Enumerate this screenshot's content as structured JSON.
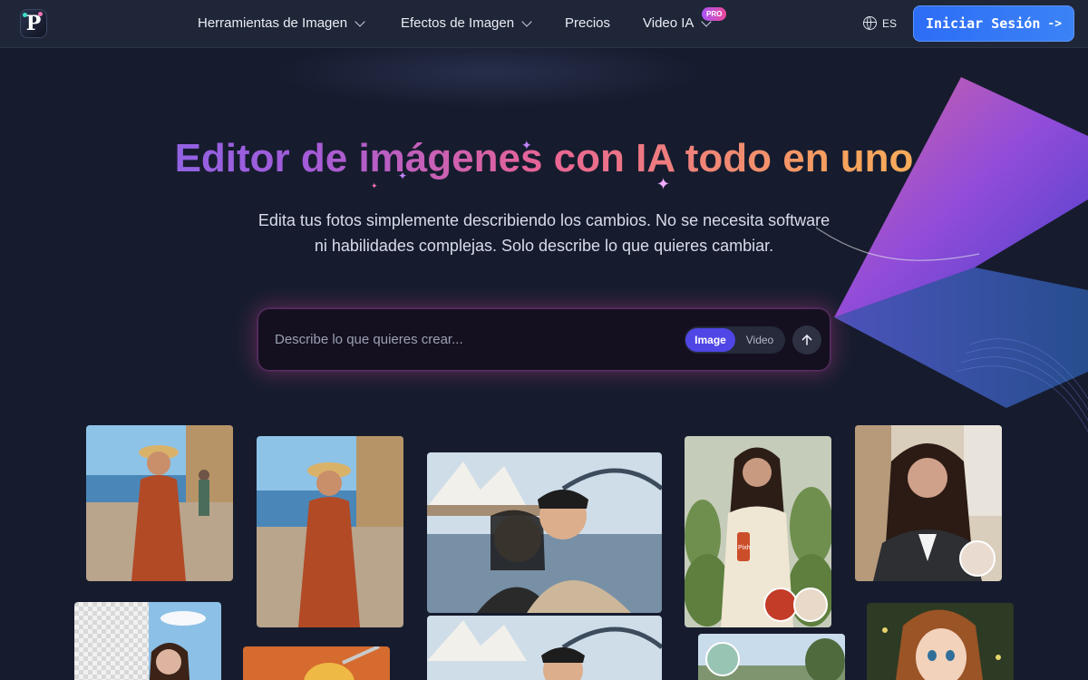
{
  "nav": {
    "logo_letter": "P",
    "items": [
      {
        "label": "Herramientas de Imagen",
        "has_dropdown": true
      },
      {
        "label": "Efectos de Imagen",
        "has_dropdown": true
      },
      {
        "label": "Precios",
        "has_dropdown": false
      },
      {
        "label": "Video IA",
        "has_dropdown": true
      }
    ],
    "pro_badge": "PRO",
    "language": "ES",
    "signin_label": "Iniciar Sesión",
    "signin_arrow": "->"
  },
  "hero": {
    "title": "Editor de imágenes con IA todo en uno",
    "subtitle": "Edita tus fotos simplemente describiendo los cambios. No se necesita software ni habilidades complejas. Solo describe lo que quieres cambiar."
  },
  "prompt": {
    "placeholder": "Describe lo que quieres crear...",
    "value": "",
    "mode_options": [
      "Image",
      "Video"
    ],
    "mode_selected": "Image",
    "send_icon": "arrow-up-icon"
  },
  "gallery": {
    "can_label": "Pixh"
  },
  "colors": {
    "background": "#161c2e",
    "nav_background": "#1f2637",
    "accent_blue": "#3b82f6",
    "mode_active": "#4f46e5",
    "title_gradient": [
      "#7c6cf0",
      "#e86495",
      "#f8c55a"
    ]
  }
}
